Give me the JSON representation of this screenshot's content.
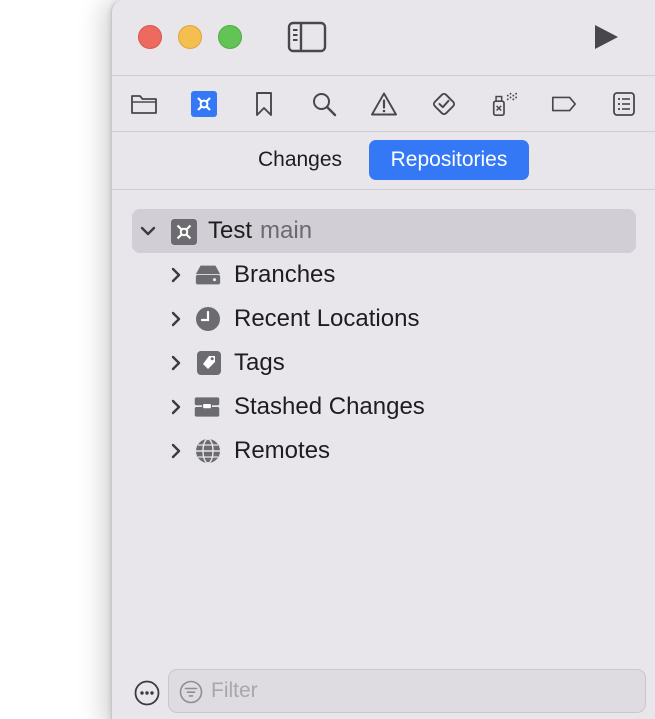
{
  "colors": {
    "accent": "#3478f6",
    "window_bg": "#e8e6eb",
    "selected_row": "#d1cfd5",
    "close": "#ed6a5e",
    "minimize": "#f5bf4f",
    "zoom": "#61c454"
  },
  "titlebar": {
    "controls": [
      "close-button",
      "minimize-button",
      "zoom-button"
    ],
    "icons": [
      "sidebar-toggle-icon",
      "run-icon"
    ]
  },
  "navigator_tabs": [
    {
      "icon": "folder-icon",
      "selected": false
    },
    {
      "icon": "source-control-icon",
      "selected": true
    },
    {
      "icon": "bookmark-icon",
      "selected": false
    },
    {
      "icon": "search-icon",
      "selected": false
    },
    {
      "icon": "warning-icon",
      "selected": false
    },
    {
      "icon": "test-icon",
      "selected": false
    },
    {
      "icon": "debug-spray-icon",
      "selected": false
    },
    {
      "icon": "breakpoint-icon",
      "selected": false
    },
    {
      "icon": "report-icon",
      "selected": false
    }
  ],
  "segmented": {
    "changes": "Changes",
    "repositories": "Repositories",
    "selected": "Repositories"
  },
  "tree": {
    "root": {
      "name": "Test",
      "branch": "main",
      "icon": "repository-icon",
      "expanded": true
    },
    "items": [
      {
        "label": "Branches",
        "icon": "branches-icon"
      },
      {
        "label": "Recent Locations",
        "icon": "clock-icon"
      },
      {
        "label": "Tags",
        "icon": "tag-icon"
      },
      {
        "label": "Stashed Changes",
        "icon": "stash-box-icon"
      },
      {
        "label": "Remotes",
        "icon": "globe-icon"
      }
    ]
  },
  "filter": {
    "placeholder": "Filter",
    "value": ""
  }
}
